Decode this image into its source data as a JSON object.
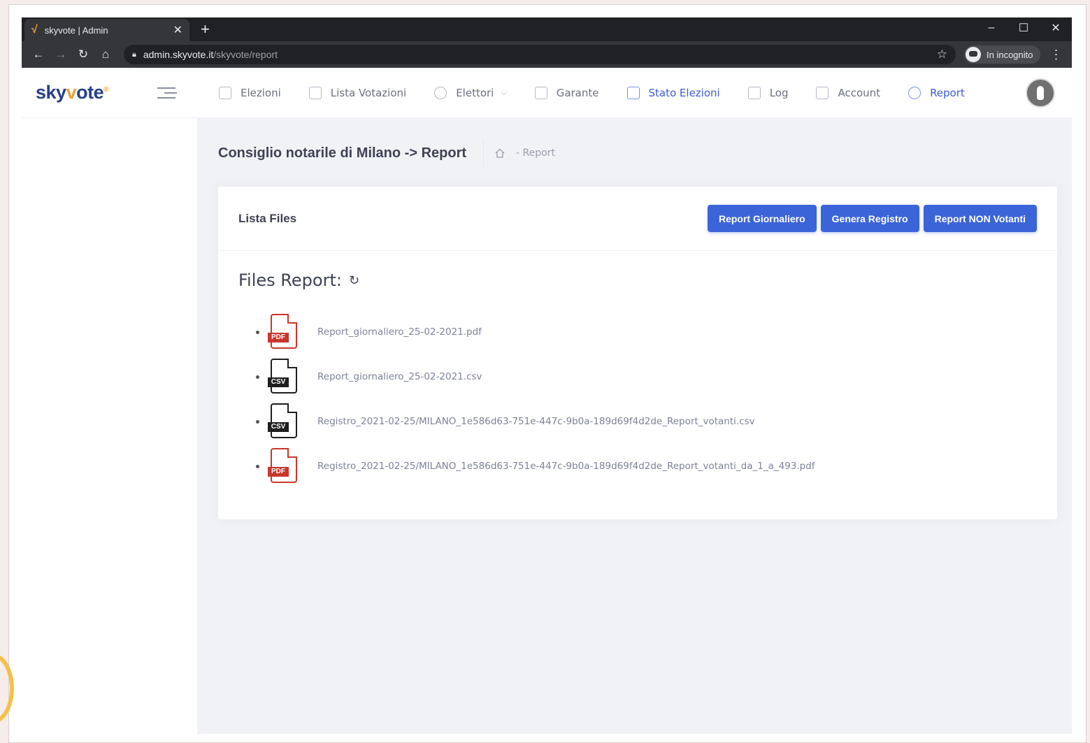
{
  "browser": {
    "tab_title": "skyvote | Admin",
    "url_host": "admin.skyvote.it",
    "url_path": "/skyvote/report",
    "incognito_label": "In incognito"
  },
  "app": {
    "logo_text": "skyvote",
    "nav": [
      {
        "label": "Elezioni",
        "icon": "add-box-icon"
      },
      {
        "label": "Lista Votazioni",
        "icon": "list-icon"
      },
      {
        "label": "Elettori",
        "icon": "user-icon"
      },
      {
        "label": "Garante",
        "icon": "shield-icon"
      },
      {
        "label": "Stato Elezioni",
        "icon": "calendar-icon"
      },
      {
        "label": "Log",
        "icon": "chat-icon"
      },
      {
        "label": "Account",
        "icon": "chat-icon"
      },
      {
        "label": "Report",
        "icon": "gear-icon"
      }
    ],
    "active_nav": "Report",
    "accent_color": "#3c64d9"
  },
  "page": {
    "title": "Consiglio notarile di Milano -> Report",
    "breadcrumb": "- Report"
  },
  "card": {
    "title": "Lista Files",
    "buttons": {
      "daily": "Report Giornaliero",
      "registry": "Genera Registro",
      "non_voters": "Report NON Votanti"
    },
    "files_heading": "Files Report:",
    "files": [
      {
        "type": "PDF",
        "name": "Report_giornaliero_25-02-2021.pdf"
      },
      {
        "type": "CSV",
        "name": "Report_giornaliero_25-02-2021.csv"
      },
      {
        "type": "CSV",
        "name": "Registro_2021-02-25/MILANO_1e586d63-751e-447c-9b0a-189d69f4d2de_Report_votanti.csv"
      },
      {
        "type": "PDF",
        "name": "Registro_2021-02-25/MILANO_1e586d63-751e-447c-9b0a-189d69f4d2de_Report_votanti_da_1_a_493.pdf"
      }
    ]
  }
}
